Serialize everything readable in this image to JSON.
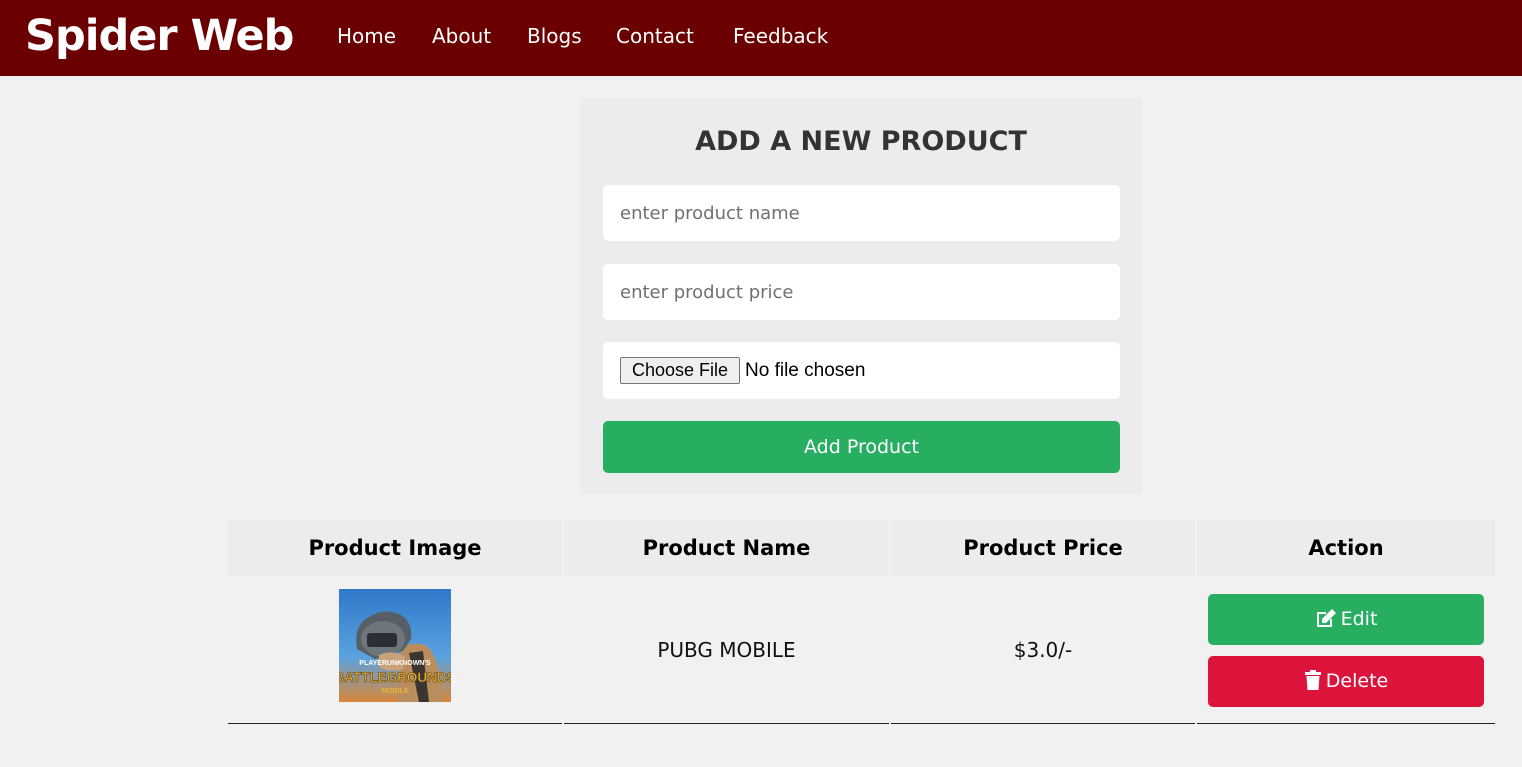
{
  "navbar": {
    "brand": "Spider Web",
    "links": [
      "Home",
      "About",
      "Blogs",
      "Contact",
      "Feedback"
    ]
  },
  "form": {
    "title": "ADD A NEW PRODUCT",
    "name_placeholder": "enter product name",
    "price_placeholder": "enter product price",
    "choose_file_label": "Choose File",
    "file_status": "No file chosen",
    "submit_label": "Add Product"
  },
  "table": {
    "headers": [
      "Product Image",
      "Product Name",
      "Product Price",
      "Action"
    ],
    "rows": [
      {
        "image_text_top": "PLAYERUNKNOWN'S",
        "image_text_main": "BATTLEGROUNDS",
        "image_text_sub": "MOBILE",
        "name": "PUBG MOBILE",
        "price": "$3.0/-",
        "edit_label": "Edit",
        "delete_label": "Delete"
      }
    ]
  },
  "colors": {
    "navbar": "#6b0000",
    "success": "#27ae60",
    "danger": "#dc143c"
  }
}
